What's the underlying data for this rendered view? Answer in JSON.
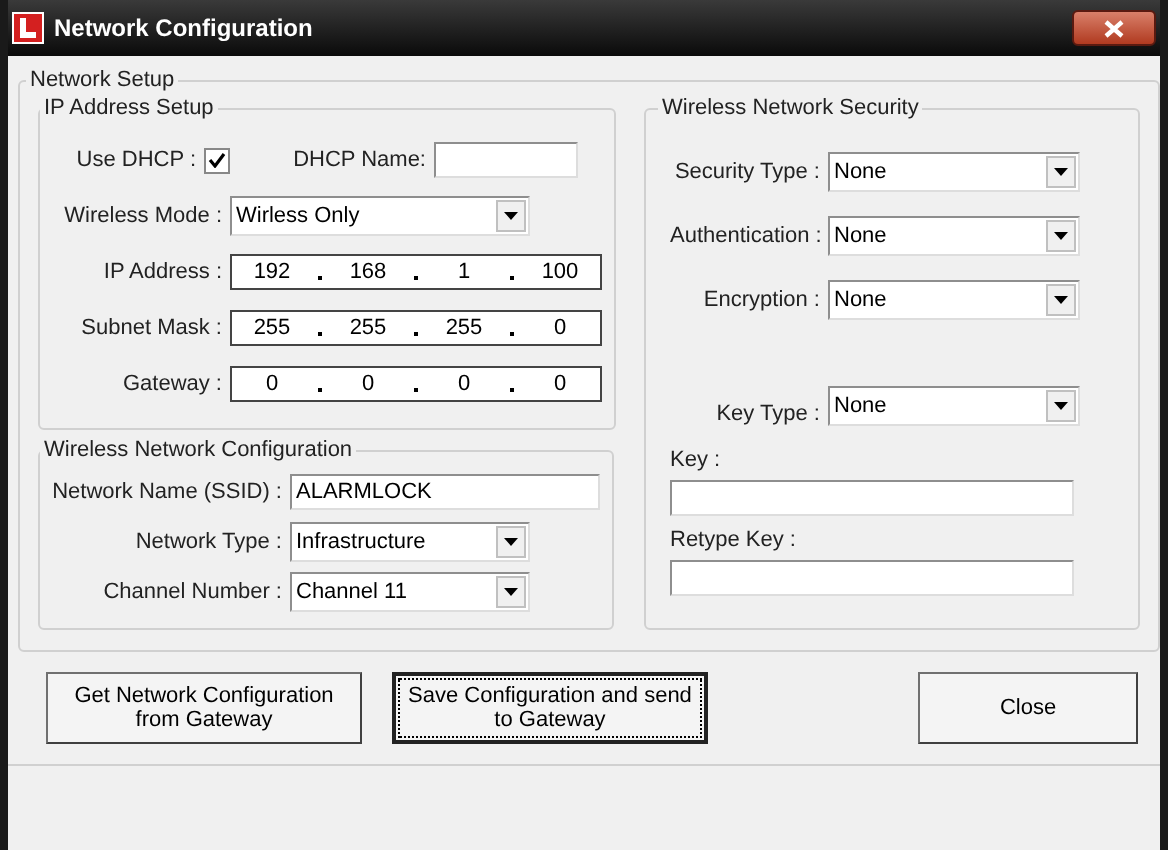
{
  "window": {
    "title": "Network Configuration"
  },
  "network_setup": {
    "title": "Network Setup"
  },
  "ip_setup": {
    "title": "IP Address Setup",
    "use_dhcp": {
      "label": "Use DHCP :",
      "checked": true
    },
    "dhcp_name": {
      "label": "DHCP Name:"
    },
    "wireless_mode": {
      "label": "Wireless Mode :",
      "value": "Wirless Only"
    },
    "addresses": [
      {
        "label": "IP Address :",
        "octets": [
          "192",
          "168",
          "1",
          "100"
        ]
      },
      {
        "label": "Subnet Mask :",
        "octets": [
          "255",
          "255",
          "255",
          "0"
        ]
      },
      {
        "label": "Gateway :",
        "octets": [
          "0",
          "0",
          "0",
          "0"
        ]
      }
    ]
  },
  "wireless_config": {
    "title": "Wireless Network Configuration",
    "fields": [
      {
        "kind": "text",
        "label": "Network Name (SSID) :",
        "value": "ALARMLOCK"
      },
      {
        "kind": "select",
        "label": "Network Type :",
        "value": "Infrastructure"
      },
      {
        "kind": "select",
        "label": "Channel Number :",
        "value": "Channel 11"
      }
    ]
  },
  "security": {
    "title": "Wireless Network Security",
    "fields": [
      {
        "kind": "select",
        "label": "Security Type :",
        "value": "None"
      },
      {
        "kind": "select",
        "label": "Authentication :",
        "value": "None"
      },
      {
        "kind": "select",
        "label": "Encryption :",
        "value": "None"
      },
      {
        "kind": "select",
        "label": "Key Type :",
        "value": "None"
      },
      {
        "kind": "text",
        "label": "Key :"
      },
      {
        "kind": "text",
        "label": "Retype Key :"
      }
    ]
  },
  "buttons": [
    {
      "label": "Get Network Configuration from Gateway",
      "focused": false
    },
    {
      "label": "Save Configuration and send to Gateway",
      "focused": true
    },
    {
      "label": "Close",
      "focused": false
    }
  ]
}
